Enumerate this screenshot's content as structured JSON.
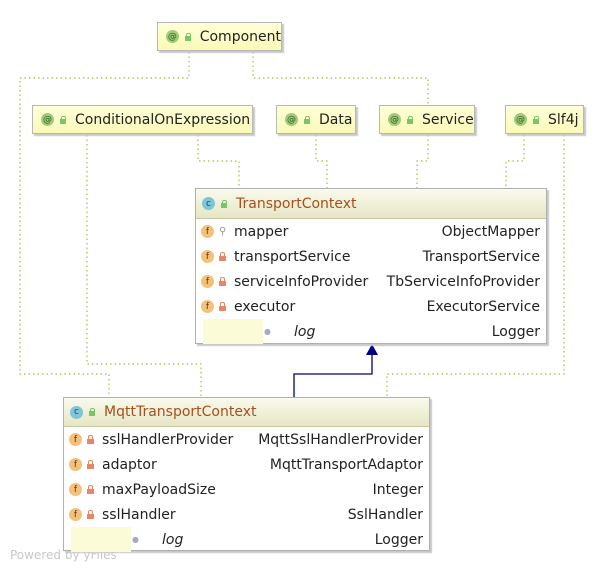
{
  "annotations": [
    {
      "name": "Component"
    },
    {
      "name": "ConditionalOnExpression"
    },
    {
      "name": "Data"
    },
    {
      "name": "Service"
    },
    {
      "name": "Slf4j"
    }
  ],
  "transport_context": {
    "name": "TransportContext",
    "fields": [
      {
        "name": "mapper",
        "type": "ObjectMapper",
        "visibility": "package"
      },
      {
        "name": "transportService",
        "type": "TransportService",
        "visibility": "private"
      },
      {
        "name": "serviceInfoProvider",
        "type": "TbServiceInfoProvider",
        "visibility": "private"
      },
      {
        "name": "executor",
        "type": "ExecutorService",
        "visibility": "private"
      },
      {
        "name": "log",
        "type": "Logger",
        "visibility": "generated"
      }
    ]
  },
  "mqtt_transport_context": {
    "name": "MqttTransportContext",
    "fields": [
      {
        "name": "sslHandlerProvider",
        "type": "MqttSslHandlerProvider",
        "visibility": "private"
      },
      {
        "name": "adaptor",
        "type": "MqttTransportAdaptor",
        "visibility": "private"
      },
      {
        "name": "maxPayloadSize",
        "type": "Integer",
        "visibility": "private"
      },
      {
        "name": "sslHandler",
        "type": "SslHandler",
        "visibility": "private"
      },
      {
        "name": "log",
        "type": "Logger",
        "visibility": "generated"
      }
    ]
  },
  "icons": {
    "annotation": "at-icon",
    "class": "c-icon",
    "field": "f-icon",
    "public": "unlock-icon",
    "private": "lock-icon"
  },
  "colors": {
    "annotation_edge": "#b5b53a",
    "inheritance_edge": "#000080",
    "class_name": "#a4501e"
  },
  "watermark": "Powered by yFiles"
}
